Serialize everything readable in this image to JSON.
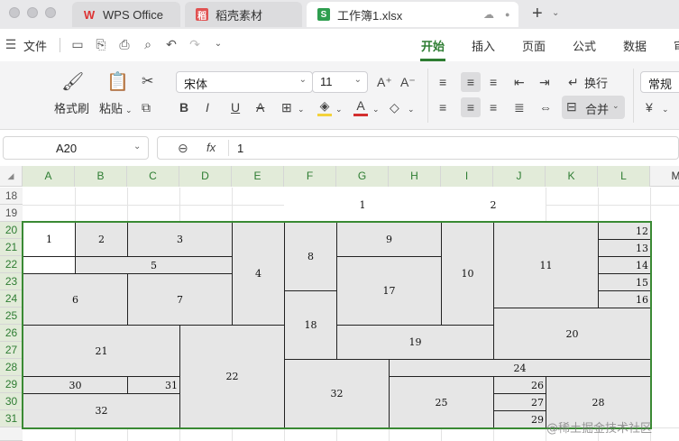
{
  "tabs": [
    {
      "label": "WPS Office",
      "icon": "wps-logo-icon"
    },
    {
      "label": "稻壳素材",
      "icon": "docer-icon"
    },
    {
      "label": "工作簿1.xlsx",
      "icon": "spreadsheet-icon"
    }
  ],
  "menu": {
    "file": "文件",
    "tabs": [
      "开始",
      "插入",
      "页面",
      "公式",
      "数据",
      "审"
    ]
  },
  "ribbon": {
    "format_painter": "格式刷",
    "paste": "粘贴",
    "font_name": "宋体",
    "font_size": "11",
    "wrap": "换行",
    "merge": "合并",
    "number_format": "常规",
    "currency": "¥"
  },
  "formula": {
    "name_box": "A20",
    "fx": "fx",
    "value": "1"
  },
  "columns": [
    "A",
    "B",
    "C",
    "D",
    "E",
    "F",
    "G",
    "H",
    "I",
    "J",
    "K",
    "L",
    "M"
  ],
  "rows": [
    "18",
    "19",
    "20",
    "21",
    "22",
    "23",
    "24",
    "25",
    "26",
    "27",
    "28",
    "29",
    "30",
    "31"
  ],
  "cells": {
    "r18_fg": "1",
    "r18_ij": "2",
    "c1": "1",
    "c2": "2",
    "c3": "3",
    "c4": "4",
    "c5": "5",
    "c6": "6",
    "c7": "7",
    "c8": "8",
    "c9": "9",
    "c10": "10",
    "c11": "11",
    "c12": "12",
    "c13": "13",
    "c14": "14",
    "c15": "15",
    "c16": "16",
    "c17": "17",
    "c18": "18",
    "c19": "19",
    "c20": "20",
    "c21": "21",
    "c22": "22",
    "c24": "24",
    "c25": "25",
    "c26": "26",
    "c27": "27",
    "c28": "28",
    "c29": "29",
    "c30": "30",
    "c31": "31",
    "c32a": "32",
    "c32b": "32"
  },
  "watermark": "@稀土掘金技术社区",
  "colors": {
    "accent": "#2e7d32",
    "selection": "#3a8a34"
  }
}
